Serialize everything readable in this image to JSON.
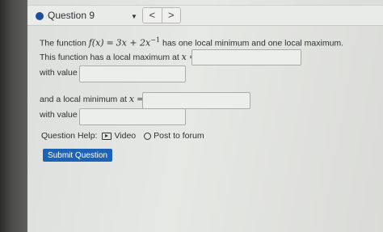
{
  "question_bar": {
    "label": "Question 9",
    "dropdown_glyph": "▼",
    "prev_glyph": "<",
    "next_glyph": ">"
  },
  "problem": {
    "intro": "The function",
    "function_lhs": "f(x)",
    "equals": "=",
    "function_rhs": "3x + 2x",
    "exponent": "−1",
    "statement": "has one local minimum and one local maximum.",
    "max_prompt": "This function has a local maximum at",
    "max_var": "x",
    "max_value_prompt": "with value",
    "min_prompt": "and a local minimum at",
    "min_var": "x",
    "min_value_prompt": "with value"
  },
  "inputs": {
    "max_x": "",
    "max_value": "",
    "min_x": "",
    "min_value": ""
  },
  "help": {
    "label": "Question Help:",
    "video": "Video",
    "post": "Post to forum"
  },
  "submit_label": "Submit Question",
  "colors": {
    "accent": "#1d63b5",
    "bullet": "#1c4e9b"
  }
}
